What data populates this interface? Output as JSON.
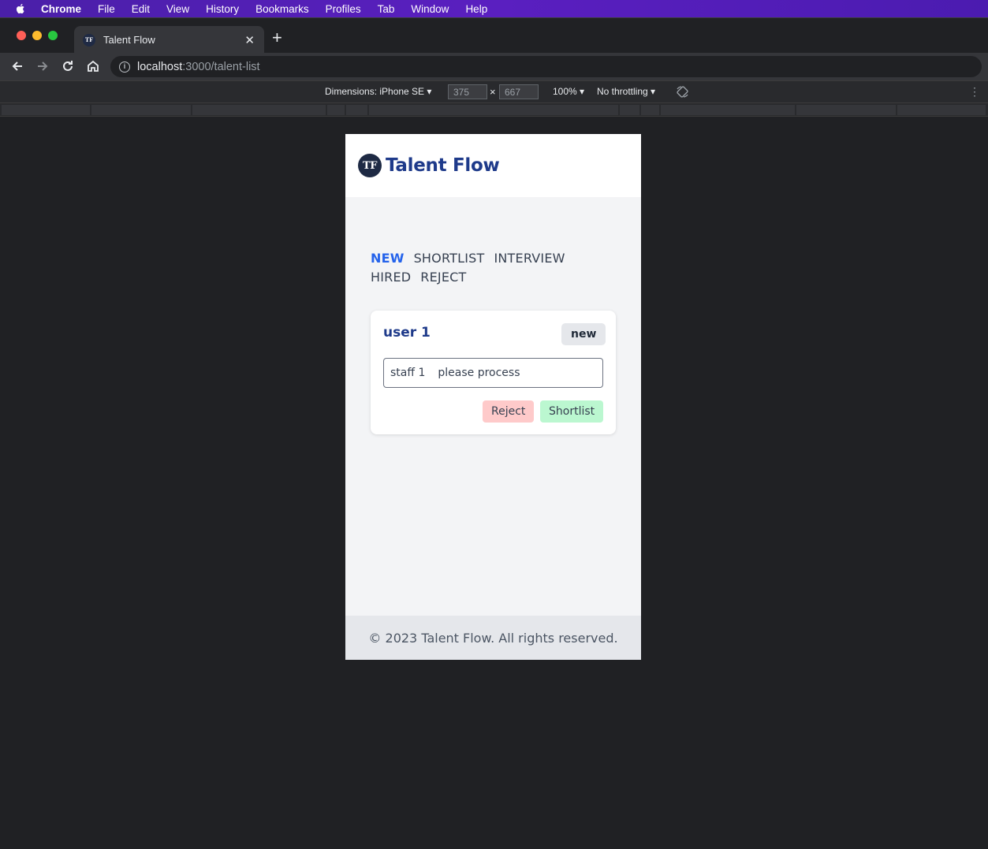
{
  "menubar": {
    "app": "Chrome",
    "items": [
      "File",
      "Edit",
      "View",
      "History",
      "Bookmarks",
      "Profiles",
      "Tab",
      "Window",
      "Help"
    ]
  },
  "browser": {
    "tab_title": "Talent Flow",
    "tab_favicon": "TF",
    "url_host": "localhost",
    "url_path": ":3000/talent-list"
  },
  "devtools": {
    "dimensions_label": "Dimensions: iPhone SE",
    "width": "375",
    "height": "667",
    "zoom": "100%",
    "throttling": "No throttling"
  },
  "app": {
    "logo_text": "TF",
    "brand": "Talent Flow",
    "status_tabs": [
      {
        "label": "NEW",
        "active": true
      },
      {
        "label": "SHORTLIST",
        "active": false
      },
      {
        "label": "INTERVIEW",
        "active": false
      },
      {
        "label": "HIRED",
        "active": false
      },
      {
        "label": "REJECT",
        "active": false
      }
    ],
    "card": {
      "name": "user 1",
      "status_badge": "new",
      "note_author": "staff 1",
      "note_text": "please process",
      "reject_label": "Reject",
      "shortlist_label": "Shortlist"
    },
    "footer": "© 2023 Talent Flow. All rights reserved."
  },
  "colors": {
    "accent_active_tab": "#2563eb",
    "brand": "#1e3a8a",
    "reject_bg": "#fecaca",
    "shortlist_bg": "#bbf7d0"
  }
}
